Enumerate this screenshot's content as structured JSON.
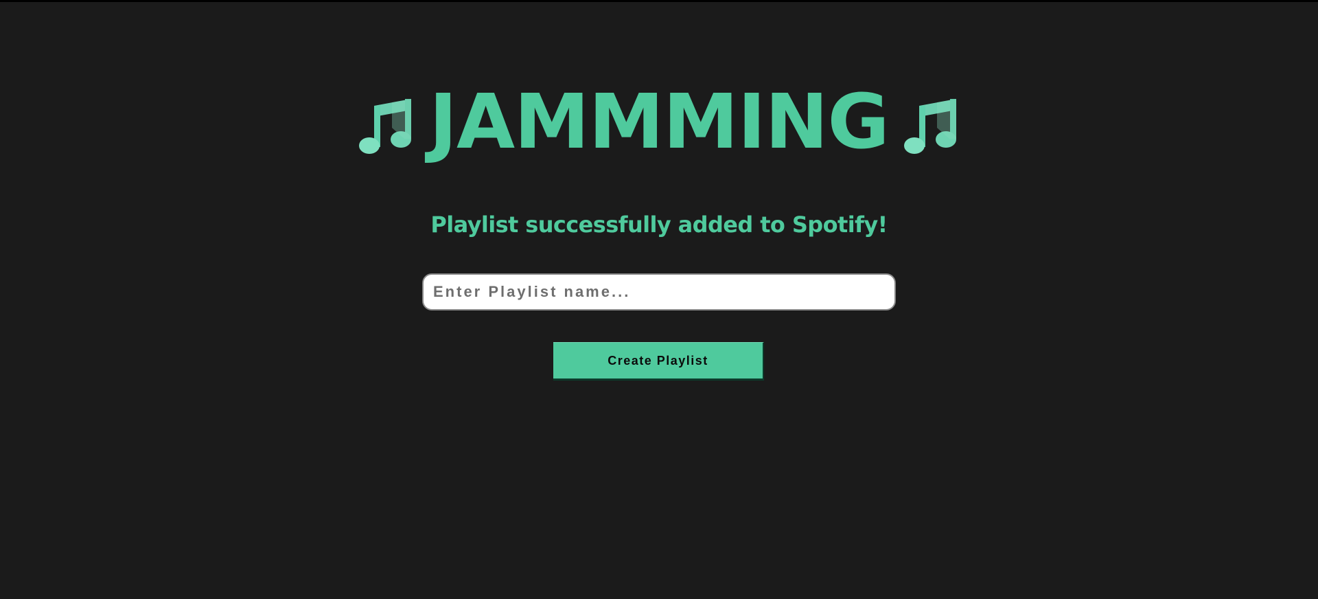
{
  "header": {
    "title": "JAMMMING",
    "left_icon": "music-note-icon",
    "right_icon": "music-note-icon"
  },
  "status": {
    "message": "Playlist successfully added to Spotify!"
  },
  "playlist_form": {
    "name_value": "",
    "name_placeholder": "Enter Playlist name...",
    "create_label": "Create Playlist"
  },
  "colors": {
    "background": "#1b1b1b",
    "accent": "#4fca9d",
    "input_background": "#ffffff",
    "button_text": "#0b0b0b"
  }
}
